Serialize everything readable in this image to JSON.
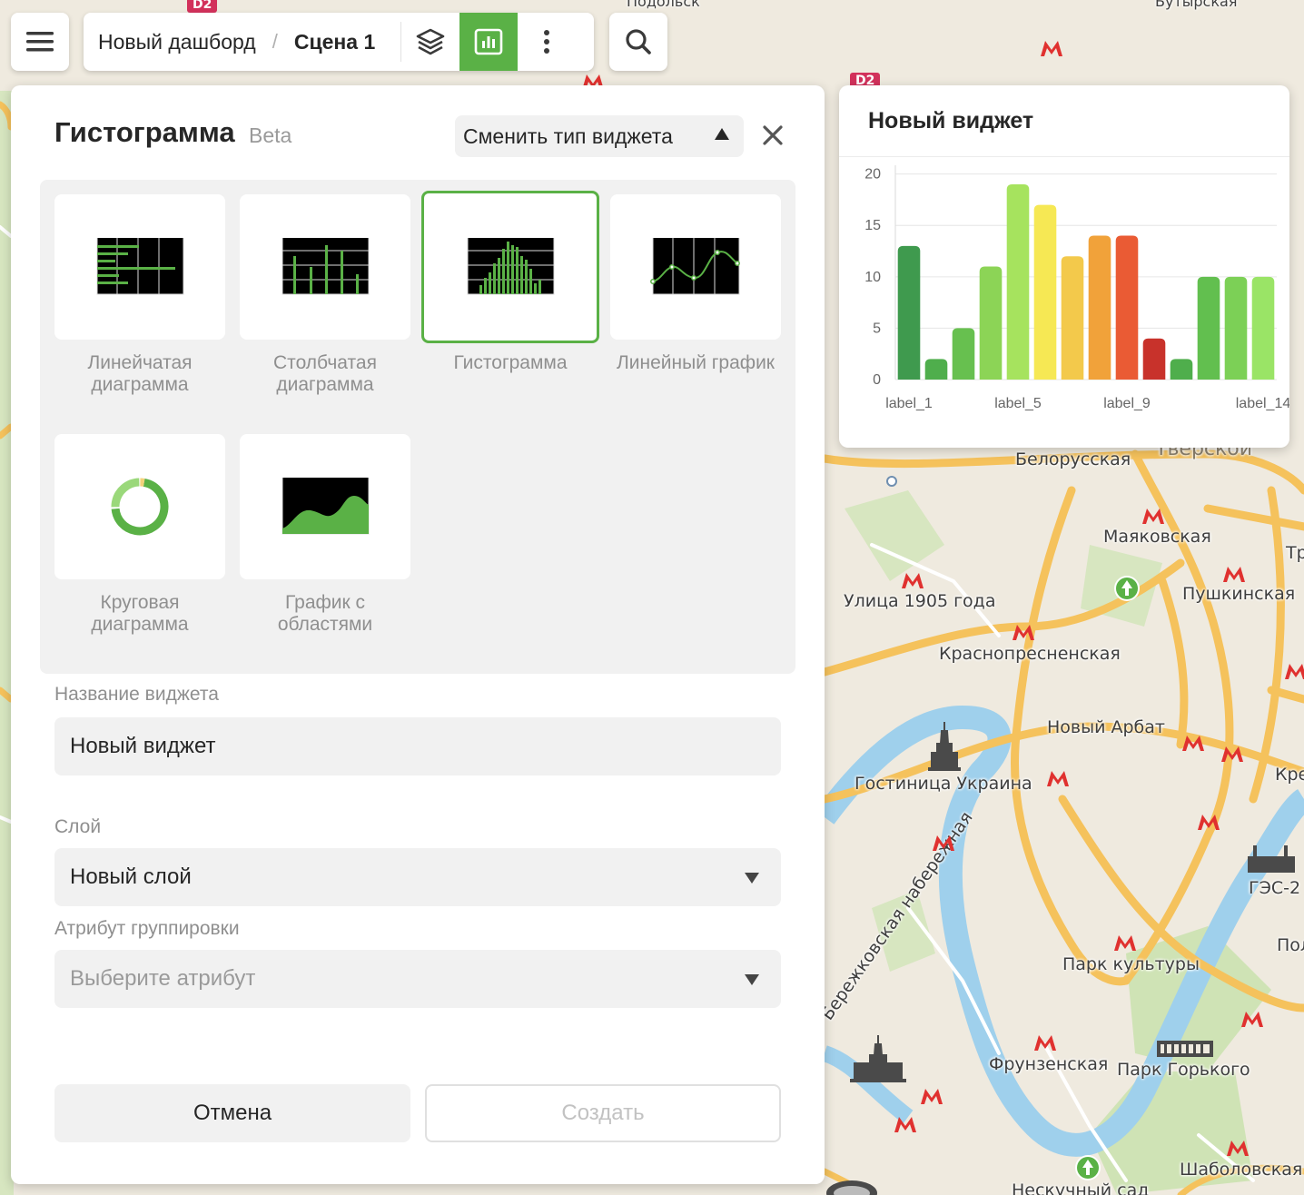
{
  "toolbar": {
    "breadcrumb_root": "Новый дашборд",
    "breadcrumb_separator": "/",
    "breadcrumb_current": "Сцена 1",
    "accent_color": "#5ab146"
  },
  "editor": {
    "title": "Гистограмма",
    "badge": "Beta",
    "change_type_label": "Сменить тип виджета",
    "widget_types": [
      {
        "label": "Линейчатая диаграмма",
        "icon": "bar-horizontal-chart-icon",
        "selected": false
      },
      {
        "label": "Столбчатая диаграмма",
        "icon": "column-chart-icon",
        "selected": false
      },
      {
        "label": "Гистограмма",
        "icon": "histogram-chart-icon",
        "selected": true
      },
      {
        "label": "Линейный график",
        "icon": "line-chart-icon",
        "selected": false
      },
      {
        "label": "Круговая диаграмма",
        "icon": "donut-chart-icon",
        "selected": false
      },
      {
        "label": "График с областями",
        "icon": "area-chart-icon",
        "selected": false
      }
    ],
    "name_label": "Название виджета",
    "name_value": "Новый виджет",
    "layer_label": "Слой",
    "layer_value": "Новый слой",
    "group_label": "Атрибут группировки",
    "group_placeholder": "Выберите атрибут",
    "cancel_label": "Отмена",
    "create_label": "Создать"
  },
  "preview": {
    "title": "Новый виджет"
  },
  "chart_data": {
    "type": "bar",
    "categories": [
      "label_1",
      "label_2",
      "label_3",
      "label_4",
      "label_5",
      "label_6",
      "label_7",
      "label_8",
      "label_9",
      "label_10",
      "label_11",
      "label_12",
      "label_13",
      "label_14"
    ],
    "values": [
      13,
      2,
      5,
      11,
      19,
      17,
      12,
      14,
      14,
      4,
      2,
      10,
      10,
      10
    ],
    "colors": [
      "#3f9a4e",
      "#4fae4c",
      "#67c04f",
      "#8cd456",
      "#a6e35e",
      "#f6e854",
      "#f3c94b",
      "#f1a23a",
      "#ea5b34",
      "#c8322b",
      "#4fae4c",
      "#62bf4f",
      "#7cd056",
      "#9ae466"
    ],
    "shown_tick_labels": [
      "label_1",
      "label_5",
      "label_9",
      "label_14"
    ],
    "yticks": [
      0,
      5,
      10,
      15,
      20
    ],
    "ylim": [
      0,
      20.5
    ],
    "grid": true
  },
  "map": {
    "labels": [
      "Белорусская",
      "Маяковская",
      "Пушкинская",
      "Улица 1905 года",
      "Краснопресненская",
      "Новый Арбат",
      "Гостиница Украина",
      "Бережковская набережная",
      "ГЭС-2",
      "Парк культуры",
      "Фрунзенская",
      "Парк Горького",
      "Шаболовская",
      "Нескучный сад",
      "Подольск",
      "Бутырская",
      "Тверской",
      "Кре",
      "Пол",
      "Тр",
      "D2"
    ]
  }
}
